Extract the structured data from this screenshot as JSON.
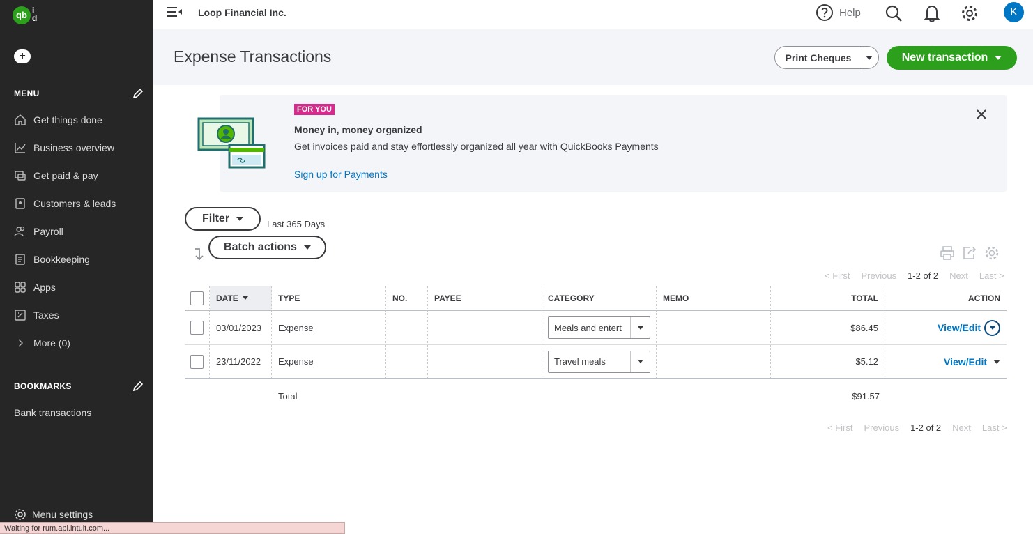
{
  "sidebar": {
    "logo": "qb",
    "logo_text": "i\nd",
    "plus": "+",
    "menu_title": "MENU",
    "items": [
      {
        "label": "Get things done",
        "icon": "home-icon"
      },
      {
        "label": "Business overview",
        "icon": "chart-line-icon"
      },
      {
        "label": "Get paid & pay",
        "icon": "payments-icon"
      },
      {
        "label": "Customers & leads",
        "icon": "contacts-icon"
      },
      {
        "label": "Payroll",
        "icon": "people-icon"
      },
      {
        "label": "Bookkeeping",
        "icon": "ledger-icon"
      },
      {
        "label": "Apps",
        "icon": "apps-grid-icon"
      },
      {
        "label": "Taxes",
        "icon": "taxes-icon"
      },
      {
        "label": "More (0)",
        "icon": "chevron-right-icon"
      }
    ],
    "bookmarks_title": "BOOKMARKS",
    "bookmarks": [
      {
        "label": "Bank transactions"
      }
    ],
    "menu_settings": "Menu settings"
  },
  "status_bar": "Waiting for rum.api.intuit.com...",
  "topbar": {
    "company": "Loop Financial Inc.",
    "help": "Help",
    "avatar": "K"
  },
  "header": {
    "title": "Expense Transactions",
    "print_label": "Print Cheques",
    "new_label": "New transaction"
  },
  "promo": {
    "badge": "FOR YOU",
    "title": "Money in, money organized",
    "text": "Get invoices paid and stay effortlessly organized all year with QuickBooks Payments",
    "link": "Sign up for Payments"
  },
  "filters": {
    "filter_label": "Filter",
    "range": "Last 365 Days",
    "batch_label": "Batch actions"
  },
  "pager": {
    "first": "< First",
    "previous": "Previous",
    "count": "1-2 of 2",
    "next": "Next",
    "last": "Last >"
  },
  "table": {
    "headers": {
      "date": "DATE",
      "type": "TYPE",
      "no": "NO.",
      "payee": "PAYEE",
      "category": "CATEGORY",
      "memo": "MEMO",
      "total": "TOTAL",
      "action": "ACTION"
    },
    "rows": [
      {
        "date": "03/01/2023",
        "type": "Expense",
        "no": "",
        "payee": "",
        "category": "Meals and entert",
        "memo": "",
        "total": "$86.45",
        "action": "View/Edit"
      },
      {
        "date": "23/11/2022",
        "type": "Expense",
        "no": "",
        "payee": "",
        "category": "Travel meals",
        "memo": "",
        "total": "$5.12",
        "action": "View/Edit"
      }
    ],
    "total_label": "Total",
    "total_value": "$91.57"
  },
  "colors": {
    "sidebar_bg": "#262626",
    "brand_green": "#2ca01c",
    "link_blue": "#0077c5",
    "badge_pink": "#d52b8c"
  }
}
